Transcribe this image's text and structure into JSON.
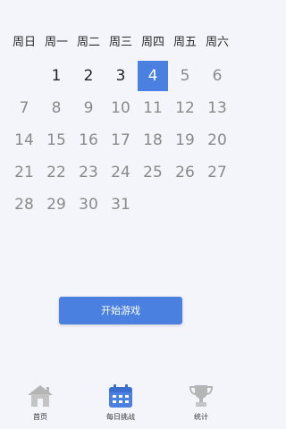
{
  "weekdays": [
    "周日",
    "周一",
    "周二",
    "周三",
    "周四",
    "周五",
    "周六"
  ],
  "calendar": {
    "first_weekday_index": 1,
    "days": [
      {
        "label": "1",
        "state": "available"
      },
      {
        "label": "2",
        "state": "available"
      },
      {
        "label": "3",
        "state": "available"
      },
      {
        "label": "4",
        "state": "selected"
      },
      {
        "label": "5",
        "state": "disabled"
      },
      {
        "label": "6",
        "state": "disabled"
      },
      {
        "label": "7",
        "state": "disabled"
      },
      {
        "label": "8",
        "state": "disabled"
      },
      {
        "label": "9",
        "state": "disabled"
      },
      {
        "label": "10",
        "state": "disabled"
      },
      {
        "label": "11",
        "state": "disabled"
      },
      {
        "label": "12",
        "state": "disabled"
      },
      {
        "label": "13",
        "state": "disabled"
      },
      {
        "label": "14",
        "state": "disabled"
      },
      {
        "label": "15",
        "state": "disabled"
      },
      {
        "label": "16",
        "state": "disabled"
      },
      {
        "label": "17",
        "state": "disabled"
      },
      {
        "label": "18",
        "state": "disabled"
      },
      {
        "label": "19",
        "state": "disabled"
      },
      {
        "label": "20",
        "state": "disabled"
      },
      {
        "label": "21",
        "state": "disabled"
      },
      {
        "label": "22",
        "state": "disabled"
      },
      {
        "label": "23",
        "state": "disabled"
      },
      {
        "label": "24",
        "state": "disabled"
      },
      {
        "label": "25",
        "state": "disabled"
      },
      {
        "label": "26",
        "state": "disabled"
      },
      {
        "label": "27",
        "state": "disabled"
      },
      {
        "label": "28",
        "state": "disabled"
      },
      {
        "label": "29",
        "state": "disabled"
      },
      {
        "label": "30",
        "state": "disabled"
      },
      {
        "label": "31",
        "state": "disabled"
      }
    ]
  },
  "start_button": {
    "label": "开始游戏"
  },
  "tabs": [
    {
      "label": "首页",
      "icon": "house-icon",
      "active": false
    },
    {
      "label": "每日挑战",
      "icon": "calendar-icon",
      "active": true
    },
    {
      "label": "统计",
      "icon": "trophy-icon",
      "active": false
    }
  ],
  "colors": {
    "accent": "#4a80df",
    "background": "#f3f5fa",
    "available_text": "#222222",
    "disabled_text": "#8a8a8a",
    "inactive_icon": "#b5b5b5"
  }
}
